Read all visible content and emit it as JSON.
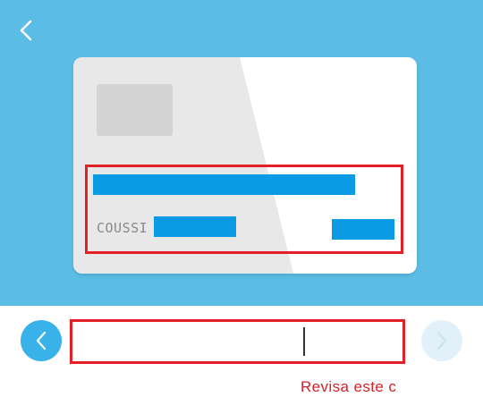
{
  "screen": {
    "background": "#ffffff",
    "header_color": "#5bbde6"
  },
  "header": {
    "back_icon": "chevron-left-icon"
  },
  "card": {
    "holder_name_visible": "COUSSI",
    "chip_color": "#d3d3d3",
    "redaction_color": "#0a9be4"
  },
  "form": {
    "input_value": "",
    "error_text": "Revisa este c",
    "highlight_color": "#e41f26",
    "prev_icon": "chevron-left-icon",
    "next_icon": "chevron-right-icon"
  }
}
